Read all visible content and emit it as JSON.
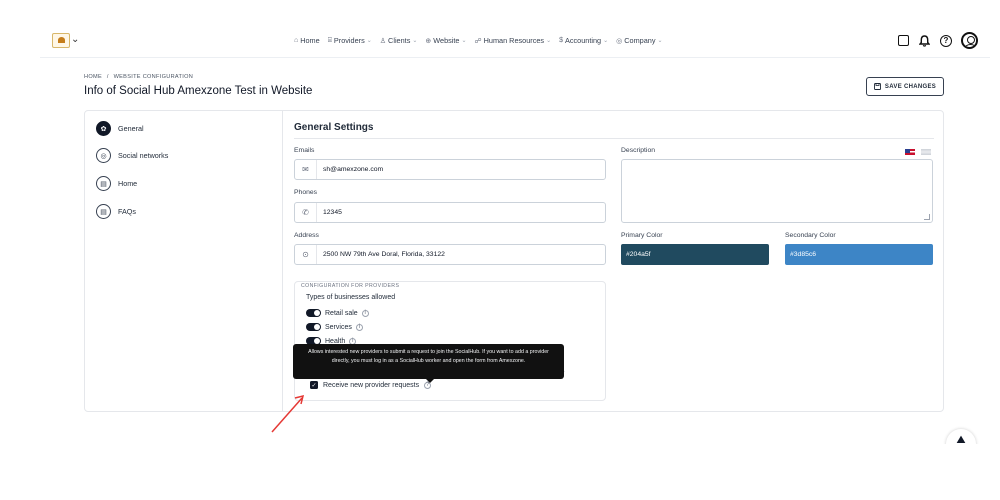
{
  "nav": {
    "items": [
      {
        "icon": "home-icon",
        "glyph": "⌂",
        "label": "Home",
        "chevron": ""
      },
      {
        "icon": "providers-icon",
        "glyph": "⌸",
        "label": "Providers",
        "chevron": "⌄"
      },
      {
        "icon": "clients-icon",
        "glyph": "♙",
        "label": "Clients",
        "chevron": "⌄"
      },
      {
        "icon": "website-icon",
        "glyph": "⊕",
        "label": "Website",
        "chevron": "⌄"
      },
      {
        "icon": "hr-icon",
        "glyph": "☍",
        "label": "Human Resources",
        "chevron": "⌄"
      },
      {
        "icon": "accounting-icon",
        "glyph": "$",
        "label": "Accounting",
        "chevron": "⌄"
      },
      {
        "icon": "company-icon",
        "glyph": "◎",
        "label": "Company",
        "chevron": "⌄"
      }
    ]
  },
  "header": {
    "breadcrumb": [
      "HOME",
      "/",
      "WEBSITE CONFIGURATION"
    ],
    "title": "Info of Social Hub Amexzone Test in Website",
    "save_label": "SAVE CHANGES"
  },
  "sidenav": {
    "items": [
      {
        "label": "General",
        "icon": "gear-icon",
        "glyph": "✿",
        "active": true
      },
      {
        "label": "Social networks",
        "icon": "instagram-icon",
        "glyph": "◎",
        "active": false
      },
      {
        "label": "Home",
        "icon": "document-icon",
        "glyph": "▤",
        "active": false
      },
      {
        "label": "FAQs",
        "icon": "document-icon",
        "glyph": "▤",
        "active": false
      }
    ]
  },
  "settings": {
    "title": "General Settings",
    "emails_label": "Emails",
    "emails_value": "sh@amexzone.com",
    "phones_label": "Phones",
    "phones_value": "12345",
    "address_label": "Address",
    "address_value": "2500 NW 79th Ave Doral, Florida, 33122",
    "description_label": "Description",
    "description_value": "",
    "primary_color_label": "Primary Color",
    "primary_color_value": "#204a5f",
    "secondary_color_label": "Secondary Color",
    "secondary_color_value": "#3d85c6"
  },
  "config": {
    "title": "CONFIGURATION FOR PROVIDERS",
    "types_label": "Types of businesses allowed",
    "types": [
      {
        "label": "Retail sale",
        "enabled": true
      },
      {
        "label": "Services",
        "enabled": true
      },
      {
        "label": "Health",
        "enabled": true
      }
    ],
    "receive_label": "Receive new provider requests",
    "receive_checked": true
  },
  "tooltip": {
    "text": "Allows interested new providers to submit a request to join the SocialHub. If you want to add a provider directly, you must log in as a SocialHub worker and open the form from Amexzone."
  },
  "colors": {
    "accent": "#111827",
    "arrow": "#e53935",
    "primary_swatch": "#204a5f",
    "secondary_swatch": "#3d85c6"
  }
}
